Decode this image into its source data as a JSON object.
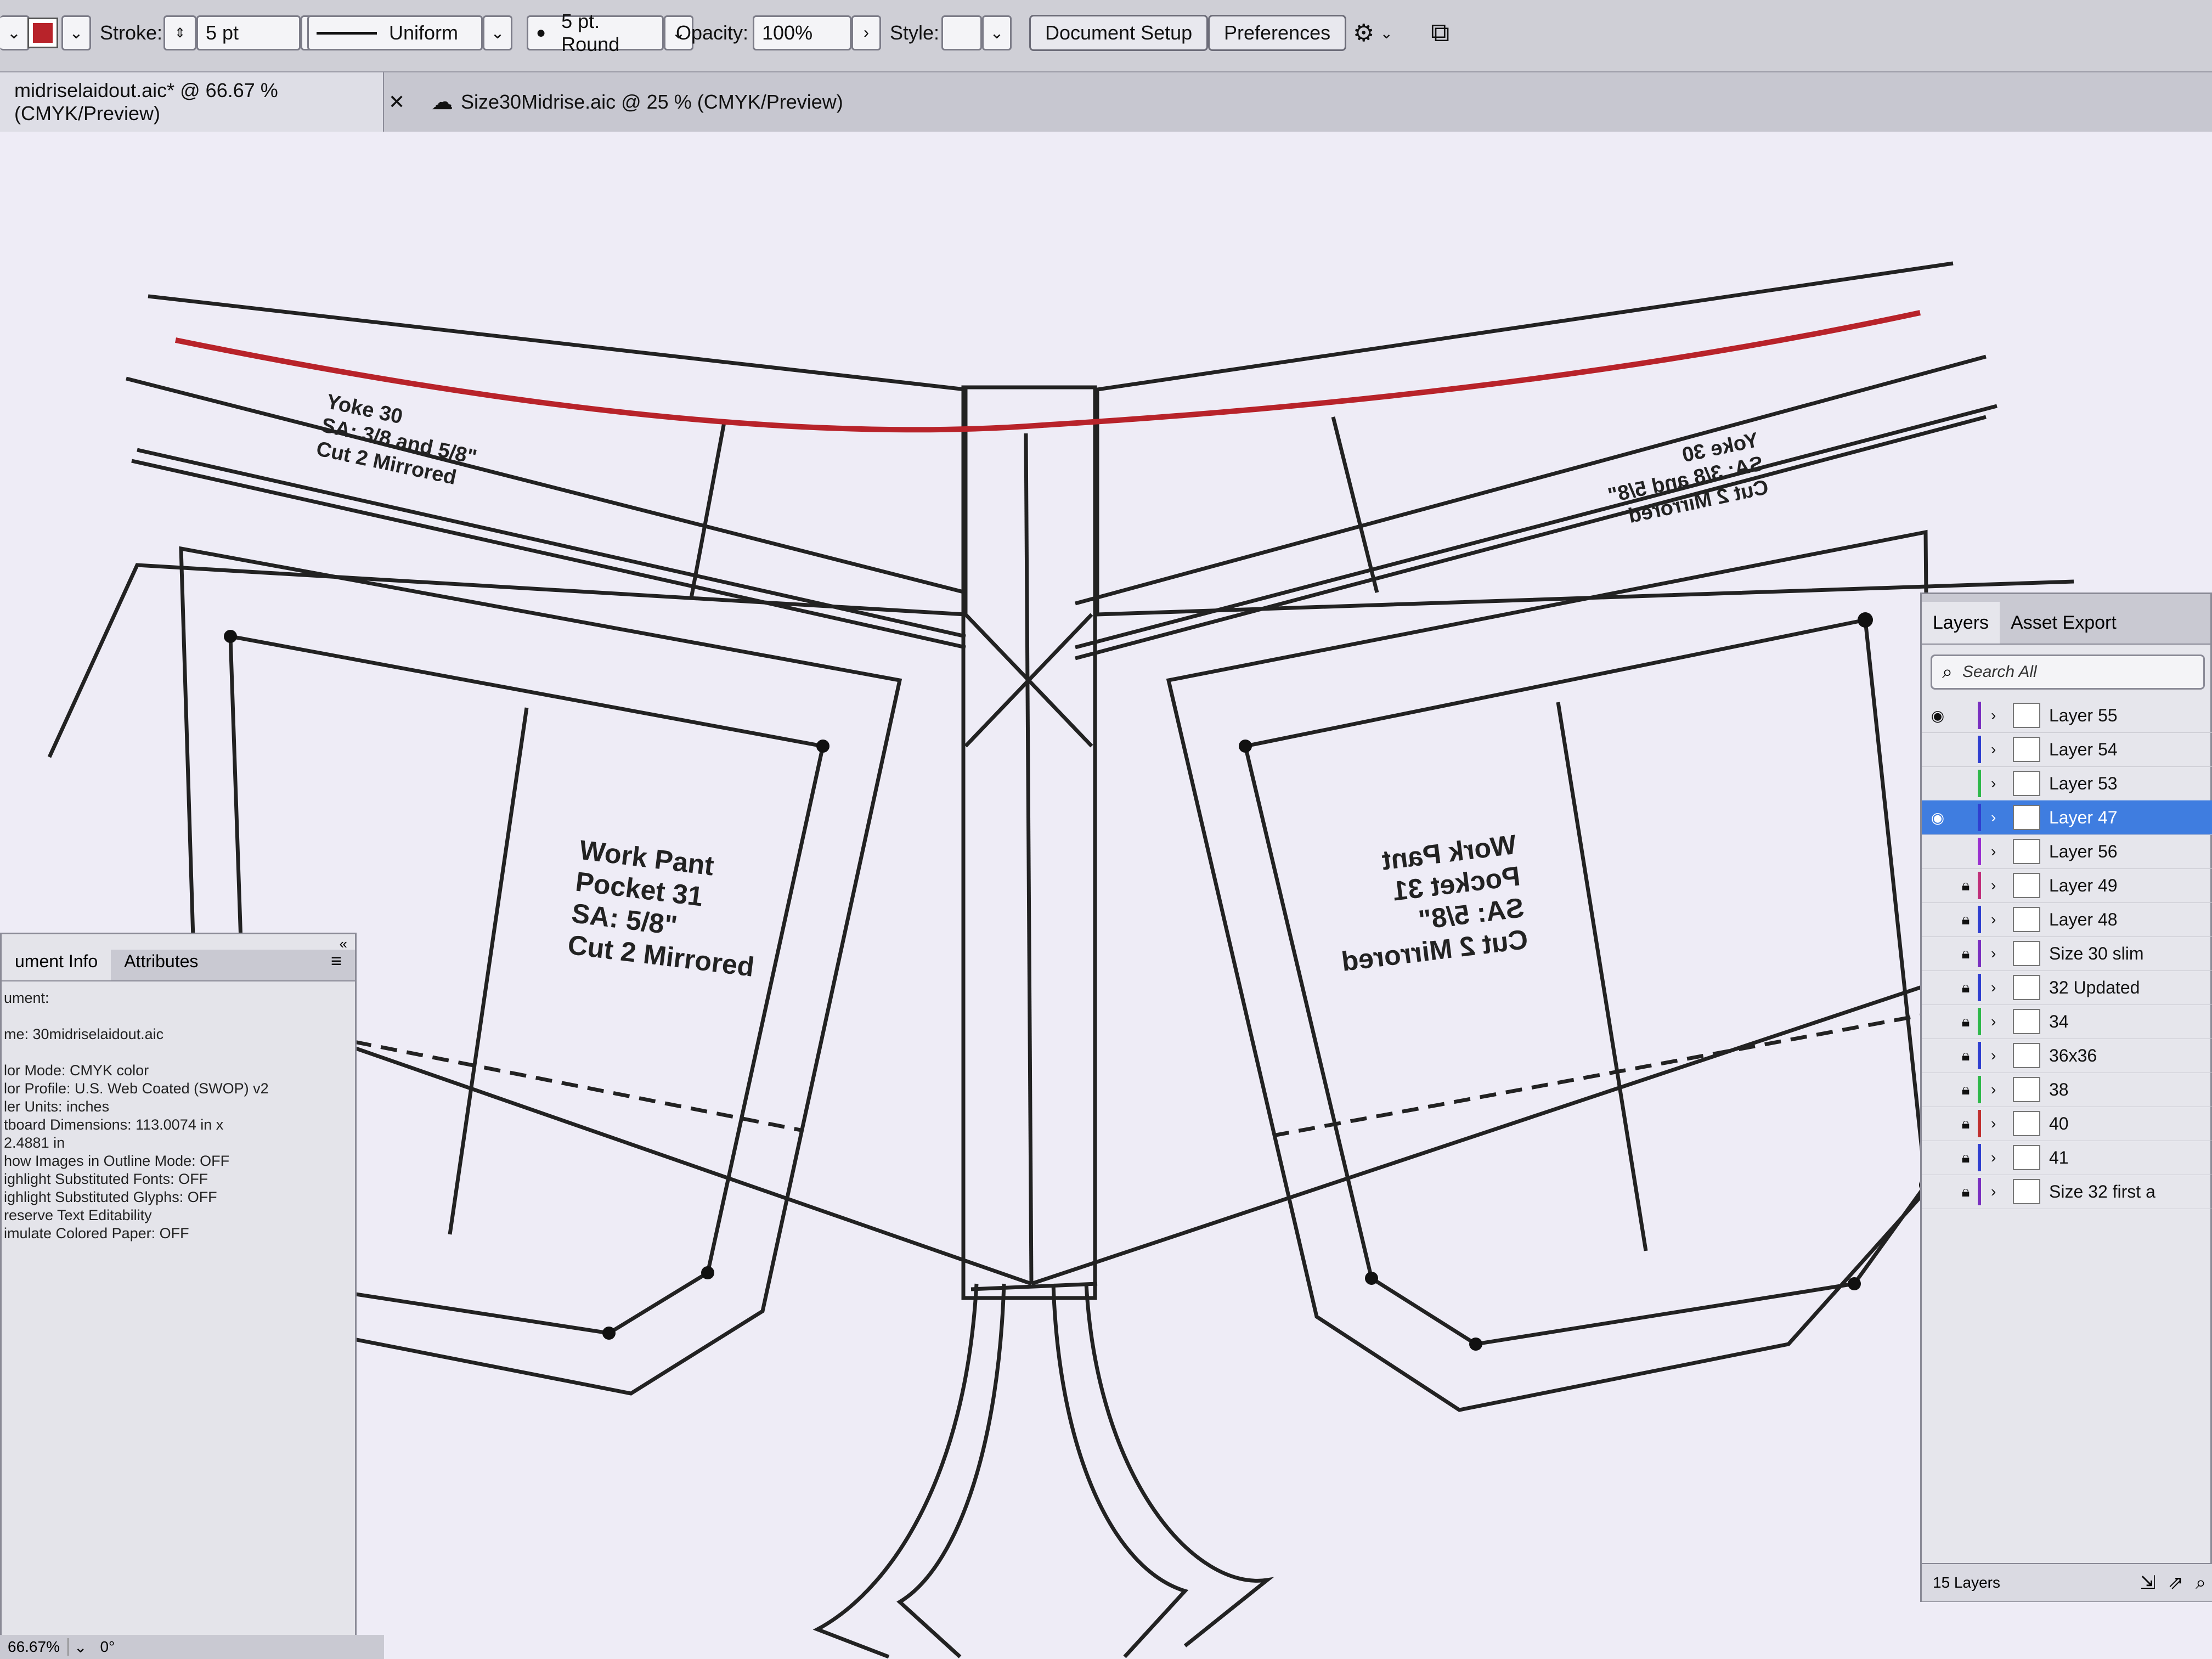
{
  "control_bar": {
    "stroke_label": "Stroke:",
    "stroke_value": "5 pt",
    "profile_value": "Uniform",
    "brush_value": "5 pt. Round",
    "opacity_label": "Opacity:",
    "opacity_value": "100%",
    "style_label": "Style:",
    "document_setup_label": "Document Setup",
    "preferences_label": "Preferences",
    "stroke_color": "#b8232a"
  },
  "tabs": [
    {
      "label": "midriselaidout.aic* @ 66.67 % (CMYK/Preview)"
    },
    {
      "label": "Size30Midrise.aic @ 25 % (CMYK/Preview)"
    }
  ],
  "pattern": {
    "yoke_left": [
      "Yoke 30",
      "SA: 3/8 and 5/8\"",
      "Cut 2 Mirrored"
    ],
    "yoke_right": [
      "Yoke 30",
      "SA: 3/8 and 5/8\"",
      "Cut 2 Mirrored"
    ],
    "pocket_left": [
      "Work Pant",
      "Pocket 31",
      "SA: 5/8\"",
      "Cut 2 Mirrored"
    ],
    "pocket_right": [
      "Work Pant",
      "Pocket 31",
      "SA: 5/8\"",
      "Cut 2 Mirrored"
    ],
    "seam_color": "#b8232a"
  },
  "doc_info": {
    "tabs": [
      "ument Info",
      "Attributes"
    ],
    "lines": [
      "ument:",
      "me: 30midriselaidout.aic",
      "lor Mode: CMYK color",
      "lor Profile: U.S. Web Coated (SWOP) v2",
      "ler Units: inches",
      "tboard Dimensions: 113.0074 in x",
      "2.4881 in",
      "how Images in Outline Mode: OFF",
      "ighlight Substituted Fonts: OFF",
      "ighlight Substituted Glyphs: OFF",
      "reserve Text Editability",
      "imulate Colored Paper: OFF"
    ]
  },
  "layers_panel": {
    "tab_layers": "Layers",
    "tab_asset_export": "Asset Export",
    "search_placeholder": "Search All",
    "layers": [
      {
        "name": "Layer 55",
        "visible": true,
        "locked": false,
        "color": "#7a2fc0"
      },
      {
        "name": "Layer 54",
        "visible": false,
        "locked": false,
        "color": "#2f3fd0"
      },
      {
        "name": "Layer 53",
        "visible": false,
        "locked": false,
        "color": "#2fb84a"
      },
      {
        "name": "Layer 47",
        "visible": true,
        "locked": false,
        "color": "#2f3fd0",
        "selected": true
      },
      {
        "name": "Layer 56",
        "visible": false,
        "locked": false,
        "color": "#9a2fd0"
      },
      {
        "name": "Layer 49",
        "visible": false,
        "locked": true,
        "color": "#c02f7a"
      },
      {
        "name": "Layer 48",
        "visible": false,
        "locked": true,
        "color": "#2f3fd0"
      },
      {
        "name": "Size 30 slim",
        "visible": false,
        "locked": true,
        "color": "#7a2fc0"
      },
      {
        "name": "32 Updated",
        "visible": false,
        "locked": true,
        "color": "#2f3fd0"
      },
      {
        "name": "34",
        "visible": false,
        "locked": true,
        "color": "#2fb84a"
      },
      {
        "name": "36x36",
        "visible": false,
        "locked": true,
        "color": "#2f3fd0"
      },
      {
        "name": "38",
        "visible": false,
        "locked": true,
        "color": "#2fb84a"
      },
      {
        "name": "40",
        "visible": false,
        "locked": true,
        "color": "#c0302f"
      },
      {
        "name": "41",
        "visible": false,
        "locked": true,
        "color": "#2f3fd0"
      },
      {
        "name": "Size 32 first a",
        "visible": false,
        "locked": true,
        "color": "#7a2fc0"
      }
    ],
    "count_label": "15 Layers"
  },
  "status_bar": {
    "zoom": "66.67%",
    "rotation": "0°"
  }
}
